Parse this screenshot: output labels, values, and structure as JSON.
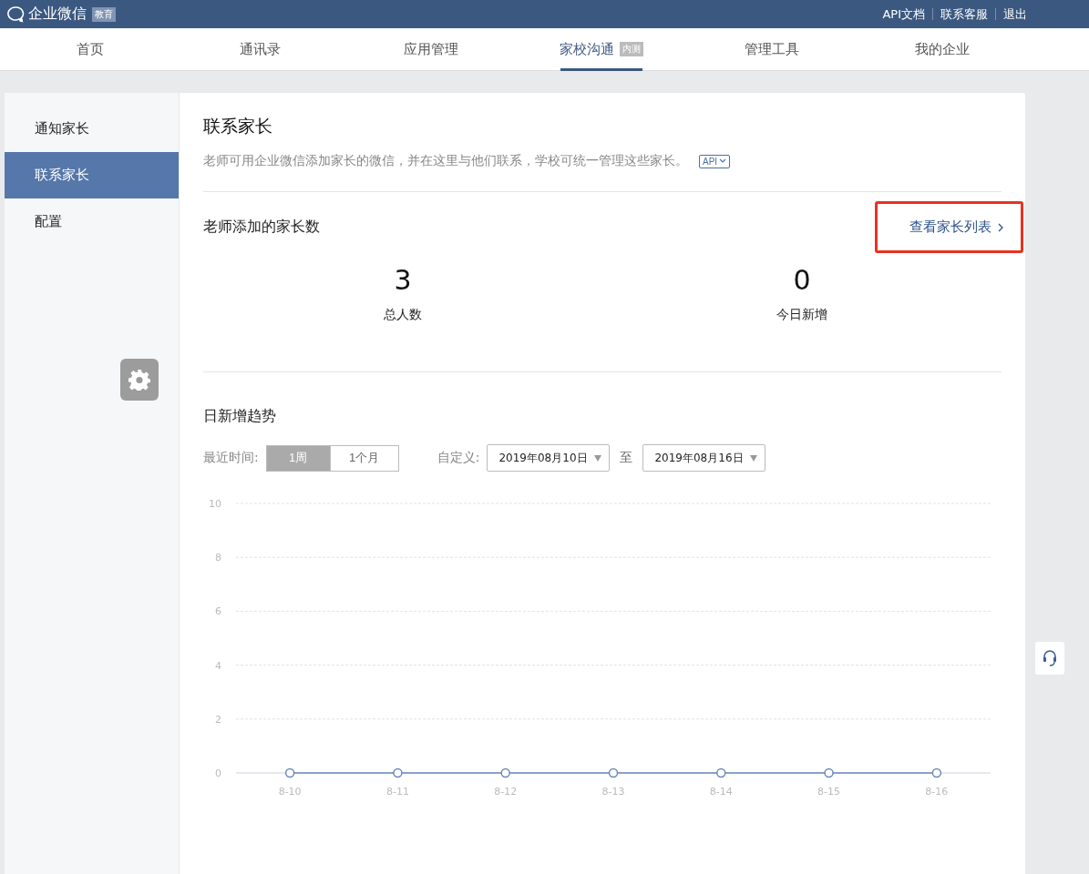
{
  "topbar": {
    "logo_text": "企业微信",
    "edition_badge": "教育",
    "links": [
      "API文档",
      "联系客服",
      "退出"
    ]
  },
  "nav_tabs": [
    {
      "label": "首页",
      "selected": false
    },
    {
      "label": "通讯录",
      "selected": false
    },
    {
      "label": "应用管理",
      "selected": false
    },
    {
      "label": "家校沟通",
      "selected": true,
      "badge": "内测"
    },
    {
      "label": "管理工具",
      "selected": false
    },
    {
      "label": "我的企业",
      "selected": false
    }
  ],
  "sidebar": {
    "items": [
      {
        "label": "通知家长",
        "selected": false
      },
      {
        "label": "联系家长",
        "selected": true
      },
      {
        "label": "配置",
        "selected": false
      }
    ]
  },
  "page": {
    "title": "联系家长",
    "description": "老师可用企业微信添加家长的微信，并在这里与他们联系，学校可统一管理这些家长。",
    "api_button": "API"
  },
  "stats_section": {
    "title": "老师添加的家长数",
    "link": "查看家长列表",
    "highlighted": true,
    "stats": [
      {
        "value": "3",
        "label": "总人数"
      },
      {
        "value": "0",
        "label": "今日新增"
      }
    ]
  },
  "trend_section": {
    "title": "日新增趋势",
    "range_label": "最近时间:",
    "range_options": [
      {
        "label": "1周",
        "selected": true
      },
      {
        "label": "1个月",
        "selected": false
      }
    ],
    "custom_label": "自定义:",
    "start_date": "2019年08月10日",
    "to_label": "至",
    "end_date": "2019年08月16日",
    "chart_data": {
      "type": "line",
      "categories": [
        "8-10",
        "8-11",
        "8-12",
        "8-13",
        "8-14",
        "8-15",
        "8-16"
      ],
      "series": [
        {
          "color": "#6a8ab8",
          "marker": true,
          "values": [
            0,
            0,
            0,
            0,
            0,
            0,
            0
          ]
        }
      ],
      "grid": true,
      "ylim": [
        0,
        10
      ],
      "yticks": [
        0,
        2,
        4,
        6,
        8,
        10
      ]
    }
  }
}
